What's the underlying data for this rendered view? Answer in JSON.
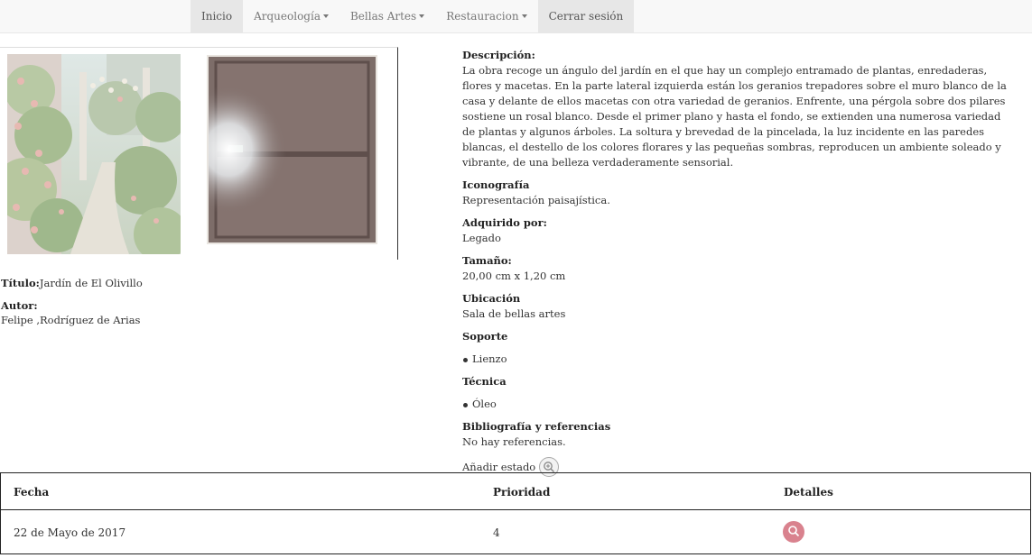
{
  "nav": {
    "items": [
      {
        "label": "Inicio",
        "active": true,
        "dropdown": false
      },
      {
        "label": "Arqueología",
        "active": false,
        "dropdown": true
      },
      {
        "label": "Bellas Artes",
        "active": false,
        "dropdown": true
      },
      {
        "label": "Restauracion",
        "active": false,
        "dropdown": true
      }
    ],
    "logout_label": "Cerrar sesión"
  },
  "artwork": {
    "title_label": "Título:",
    "title": "Jardín de El Olivillo",
    "author_label": "Autor:",
    "author": "Felipe ,Rodríguez de Arias"
  },
  "details": {
    "description_label": "Descripción:",
    "description": "La obra recoge un ángulo del jardín en el que hay un complejo entramado de plantas, enredaderas, flores y macetas. En la parte lateral izquierda están los geranios trepadores sobre el muro blanco de la casa y delante de ellos macetas con otra variedad de geranios. Enfrente, una pérgola sobre dos pilares sostiene un rosal blanco. Desde el primer plano y hasta el fondo, se extienden una numerosa variedad de plantas y algunos árboles. La soltura y brevedad de la pincelada, la luz incidente en las paredes blancas, el destello de los colores florares y las pequeñas sombras, reproducen un ambiente soleado y vibrante, de una belleza verdaderamente sensorial.",
    "iconography_label": "Iconografía",
    "iconography": "Representación paisajística.",
    "acquired_label": "Adquirido por:",
    "acquired": "Legado",
    "size_label": "Tamaño:",
    "size": "20,00 cm x 1,20 cm",
    "location_label": "Ubicación",
    "location": "Sala de bellas artes",
    "support_label": "Soporte",
    "support": [
      "Lienzo"
    ],
    "technique_label": "Técnica",
    "technique": [
      "Óleo"
    ],
    "biblio_label": "Bibliografía y referencias",
    "biblio": "No hay referencias.",
    "add_state_label": "Añadir estado"
  },
  "table": {
    "headers": [
      "Fecha",
      "Prioridad",
      "Detalles"
    ],
    "rows": [
      {
        "date": "22 de Mayo de 2017",
        "priority": "4"
      }
    ]
  },
  "icons": {
    "add_state": "search-plus-icon",
    "details": "search-icon"
  },
  "colors": {
    "details_button": "#d9828e",
    "navbar_bg": "#f8f8f8"
  }
}
